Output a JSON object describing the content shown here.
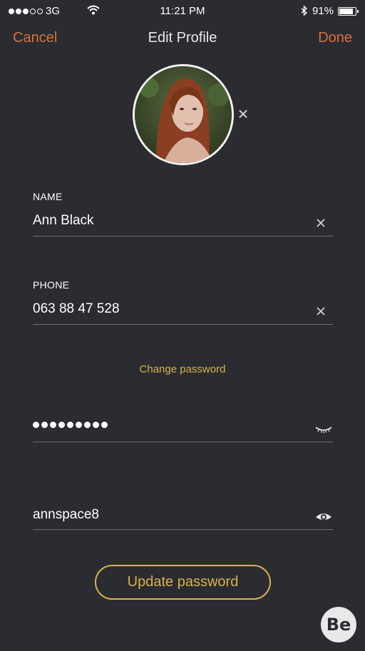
{
  "status_bar": {
    "carrier": "3G",
    "time": "11:21 PM",
    "battery_percent": "91%",
    "battery_level": 0.91,
    "signal_bars_filled": 3,
    "signal_bars_total": 5
  },
  "nav": {
    "cancel_label": "Cancel",
    "title": "Edit Profile",
    "done_label": "Done"
  },
  "profile": {
    "avatar_icon": "user-photo"
  },
  "form": {
    "name_label": "NAME",
    "name_value": "Ann Black",
    "phone_label": "PHONE",
    "phone_value": "063 88 47 528",
    "change_password_label": "Change password",
    "current_password_masked_length": 9,
    "new_password_value": "annspace8",
    "update_button_label": "Update password"
  },
  "colors": {
    "background": "#2b2c31",
    "accent_orange": "#d8703d",
    "accent_gold": "#d9b24a"
  },
  "watermark": {
    "text": "Be"
  }
}
